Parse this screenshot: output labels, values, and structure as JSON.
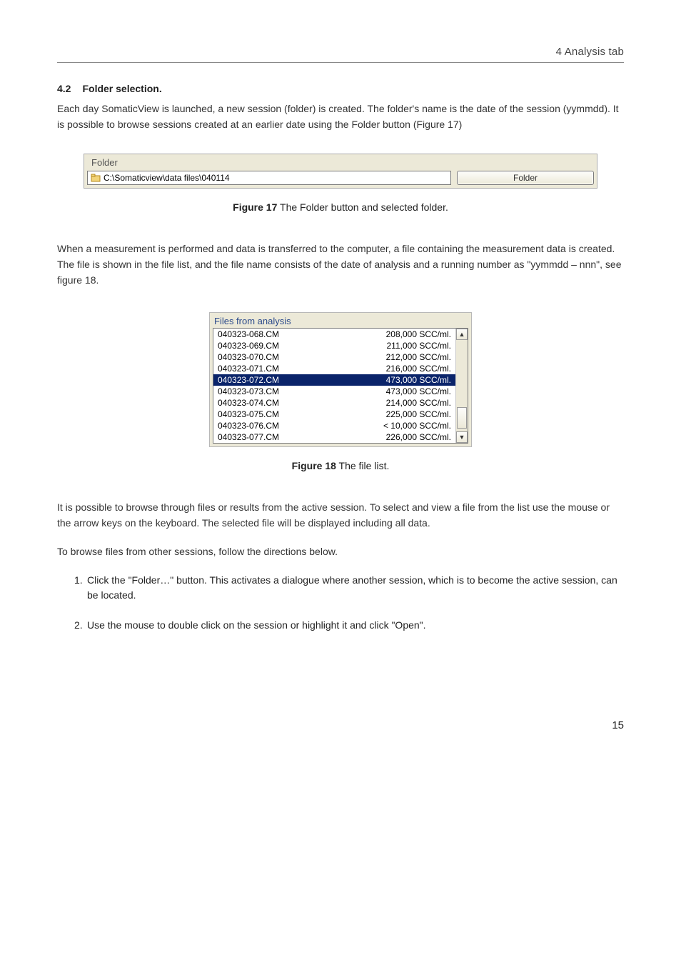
{
  "header": {
    "context": "4 Analysis tab"
  },
  "section": {
    "number": "4.2",
    "title": "Folder selection."
  },
  "p1": "Each day SomaticView is launched, a new session (folder) is created. The folder's name is the date of the session (yymmdd). It is possible to browse sessions created at an earlier date using the Folder button (Figure 17)",
  "folder_panel": {
    "group_label": "Folder",
    "path_value": "C:\\Somaticview\\data files\\040114",
    "button_label": "Folder"
  },
  "fig17": {
    "label": "Figure 17",
    "caption": " The Folder button and selected folder."
  },
  "p2": "When a measurement is performed and data is transferred to the computer, a file containing the measurement data is created. The file is shown in the file list, and the file name consists of the date of analysis and a running number as \"yymmdd – nnn\", see figure 18.",
  "file_list_panel": {
    "group_label": "Files from analysis",
    "items": [
      {
        "name": "040323-068.CM",
        "value": "208,000 SCC/ml.",
        "selected": false
      },
      {
        "name": "040323-069.CM",
        "value": "211,000 SCC/ml.",
        "selected": false
      },
      {
        "name": "040323-070.CM",
        "value": "212,000 SCC/ml.",
        "selected": false
      },
      {
        "name": "040323-071.CM",
        "value": "216,000 SCC/ml.",
        "selected": false
      },
      {
        "name": "040323-072.CM",
        "value": "473,000 SCC/ml.",
        "selected": true
      },
      {
        "name": "040323-073.CM",
        "value": "473,000 SCC/ml.",
        "selected": false
      },
      {
        "name": "040323-074.CM",
        "value": "214,000 SCC/ml.",
        "selected": false
      },
      {
        "name": "040323-075.CM",
        "value": "225,000 SCC/ml.",
        "selected": false
      },
      {
        "name": "040323-076.CM",
        "value": "< 10,000 SCC/ml.",
        "selected": false
      },
      {
        "name": "040323-077.CM",
        "value": "226,000 SCC/ml.",
        "selected": false
      }
    ]
  },
  "fig18": {
    "label": "Figure 18",
    "caption": " The file list."
  },
  "p3": "It is possible to browse through files or results from the active session. To select and view a file from the list use the mouse or the arrow keys on the keyboard. The selected file will be displayed including all data.",
  "p4": "To browse files from other sessions, follow the directions below.",
  "steps": [
    {
      "n": "1.",
      "text": "Click the \"Folder…\" button. This activates a dialogue where another session, which is to become the active session, can be located."
    },
    {
      "n": "2.",
      "text": "Use the mouse to double click on the session or highlight it and click \"Open\"."
    }
  ],
  "page_number": "15"
}
